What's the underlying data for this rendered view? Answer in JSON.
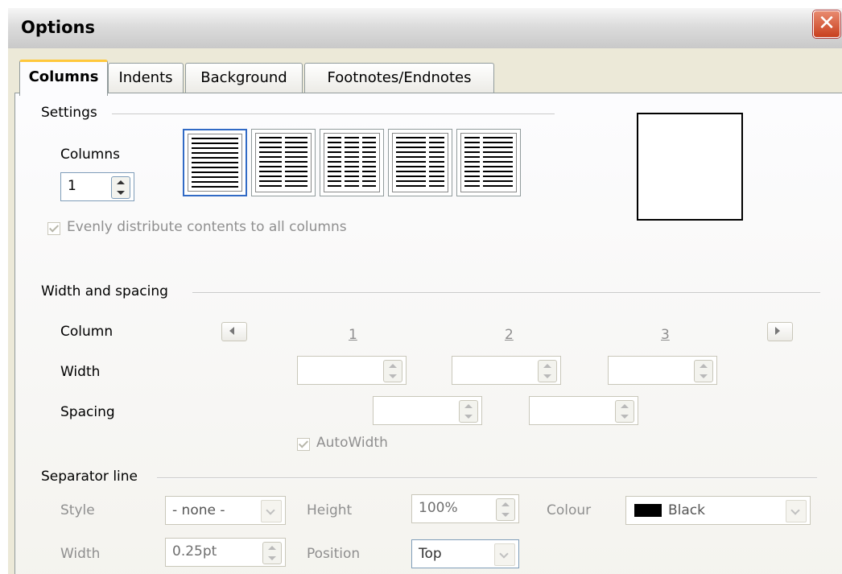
{
  "window": {
    "title": "Options"
  },
  "tabs": [
    {
      "label": "Columns",
      "active": true
    },
    {
      "label": "Indents",
      "active": false
    },
    {
      "label": "Background",
      "active": false
    },
    {
      "label": "Footnotes/Endnotes",
      "active": false
    }
  ],
  "settings": {
    "group_label": "Settings",
    "columns_label": "Columns",
    "columns_value": "1",
    "presets": [
      "1-column",
      "2-columns",
      "3-columns",
      "2-columns-left-wide",
      "2-columns-right-wide"
    ],
    "evenly_label": "Evenly distribute contents to all columns",
    "evenly_checked": true
  },
  "width_spacing": {
    "group_label": "Width and spacing",
    "column_label": "Column",
    "col_numbers": [
      "1",
      "2",
      "3"
    ],
    "width_label": "Width",
    "spacing_label": "Spacing",
    "width_values": [
      "",
      "",
      ""
    ],
    "spacing_values": [
      "",
      ""
    ],
    "autowidth_label": "AutoWidth",
    "autowidth_checked": true
  },
  "separator": {
    "group_label": "Separator line",
    "style_label": "Style",
    "style_value": "- none -",
    "height_label": "Height",
    "height_value": "100%",
    "colour_label": "Colour",
    "colour_value": "Black",
    "colour_swatch": "#000000",
    "width_label": "Width",
    "width_value": "0.25pt",
    "position_label": "Position",
    "position_value": "Top"
  },
  "colors": {
    "accent": "#ffc83c",
    "close_button": "#c8401e",
    "disabled_text": "#8f8f8f"
  }
}
